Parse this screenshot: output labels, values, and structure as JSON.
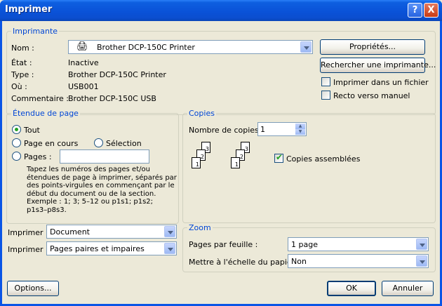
{
  "window": {
    "title": "Imprimer",
    "help": "?",
    "close": "X"
  },
  "printer": {
    "legend": "Imprimante",
    "name_label": "Nom :",
    "name_value": "Brother DCP-150C Printer",
    "state_label": "État :",
    "state_value": "Inactive",
    "type_label": "Type :",
    "type_value": "Brother DCP-150C Printer",
    "where_label": "Où :",
    "where_value": "USB001",
    "comment_label": "Commentaire :",
    "comment_value": "Brother DCP-150C USB",
    "properties_button": "Propriétés...",
    "find_button": "Rechercher une imprimante...",
    "print_to_file": "Imprimer dans un fichier",
    "duplex": "Recto verso manuel",
    "print_to_file_checked": false,
    "duplex_checked": false
  },
  "range": {
    "legend": "Étendue de page",
    "all": "Tout",
    "current": "Page en cours",
    "selection": "Sélection",
    "pages": "Pages :",
    "pages_value": "",
    "selected": "all",
    "help_lines": [
      "Tapez les numéros des pages et/ou",
      "étendues de page à imprimer, séparés par",
      "des points-virgules en commençant par le",
      "début du document ou de la section.",
      "Exemple : 1; 3; 5–12 ou p1s1; p1s2;",
      "p1s3–p8s3."
    ]
  },
  "copies": {
    "legend": "Copies",
    "count_label": "Nombre de copies :",
    "count_value": "1",
    "collate": "Copies assemblées",
    "collate_checked": true,
    "page_numbers": [
      "3",
      "2",
      "1"
    ]
  },
  "print_what": {
    "label": "Imprimer :",
    "value": "Document"
  },
  "print_pages": {
    "label": "Imprimer :",
    "value": "Pages paires et impaires"
  },
  "zoom": {
    "legend": "Zoom",
    "per_sheet_label": "Pages par feuille :",
    "per_sheet_value": "1 page",
    "scale_label": "Mettre à l'échelle du papier :",
    "scale_value": "Non"
  },
  "buttons": {
    "options": "Options...",
    "ok": "OK",
    "cancel": "Annuler"
  }
}
